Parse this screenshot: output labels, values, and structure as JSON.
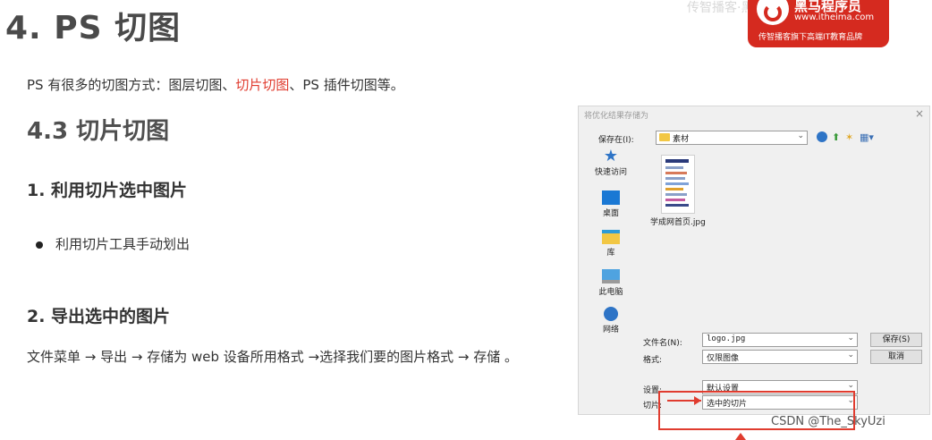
{
  "title": "4. PS 切图",
  "intro": {
    "before": "PS 有很多的切图方式：图层切图、",
    "highlight": "切片切图",
    "after": "、PS 插件切图等。"
  },
  "section_heading": "4.3 切片切图",
  "step1": {
    "heading": "1. 利用切片选中图片",
    "bullet": "利用切片工具手动划出"
  },
  "step2": {
    "heading": "2. 导出选中的图片",
    "text": "文件菜单 → 导出 → 存储为 web 设备所用格式 →选择我们要的图片格式 → 存储 。"
  },
  "logo": {
    "name": "黑马程序员",
    "url": "www.itheima.com",
    "slogan": "传智播客旗下高端IT教育品牌",
    "watermark": "传智播客·黑马程序员"
  },
  "dialog": {
    "title": "将优化结果存储为",
    "close": "×",
    "save_in_label": "保存在(I):",
    "save_in_value": "素材",
    "sidebar": [
      {
        "label": "快速访问",
        "icon": "star-icon"
      },
      {
        "label": "桌面",
        "icon": "desktop-icon"
      },
      {
        "label": "库",
        "icon": "library-icon"
      },
      {
        "label": "此电脑",
        "icon": "computer-icon"
      },
      {
        "label": "网络",
        "icon": "network-icon"
      }
    ],
    "file": {
      "name": "学成网首页.jpg"
    },
    "filename_label": "文件名(N):",
    "filename_value": "logo.jpg",
    "format_label": "格式:",
    "format_value": "仅限图像",
    "settings_label": "设置:",
    "settings_value": "默认设置",
    "slice_label": "切片:",
    "slice_value": "选中的切片",
    "save_button": "保存(S)",
    "cancel_button": "取消"
  },
  "csdn_watermark": "CSDN @The_SkyUzi",
  "colors": {
    "accent": "#e03c2f",
    "logo_red": "#d52a1f"
  }
}
